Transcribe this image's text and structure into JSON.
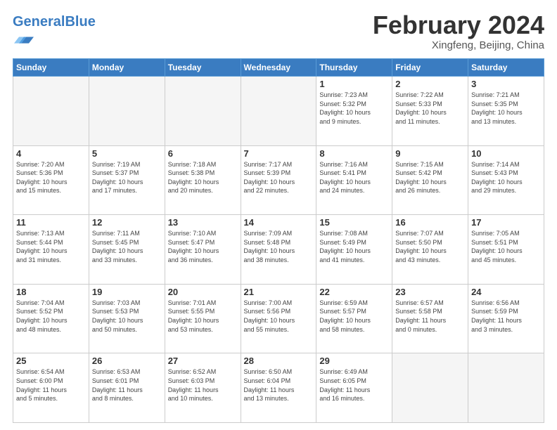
{
  "header": {
    "logo_general": "General",
    "logo_blue": "Blue",
    "month_title": "February 2024",
    "subtitle": "Xingfeng, Beijing, China"
  },
  "days_of_week": [
    "Sunday",
    "Monday",
    "Tuesday",
    "Wednesday",
    "Thursday",
    "Friday",
    "Saturday"
  ],
  "weeks": [
    [
      {
        "day": "",
        "info": ""
      },
      {
        "day": "",
        "info": ""
      },
      {
        "day": "",
        "info": ""
      },
      {
        "day": "",
        "info": ""
      },
      {
        "day": "1",
        "info": "Sunrise: 7:23 AM\nSunset: 5:32 PM\nDaylight: 10 hours\nand 9 minutes."
      },
      {
        "day": "2",
        "info": "Sunrise: 7:22 AM\nSunset: 5:33 PM\nDaylight: 10 hours\nand 11 minutes."
      },
      {
        "day": "3",
        "info": "Sunrise: 7:21 AM\nSunset: 5:35 PM\nDaylight: 10 hours\nand 13 minutes."
      }
    ],
    [
      {
        "day": "4",
        "info": "Sunrise: 7:20 AM\nSunset: 5:36 PM\nDaylight: 10 hours\nand 15 minutes."
      },
      {
        "day": "5",
        "info": "Sunrise: 7:19 AM\nSunset: 5:37 PM\nDaylight: 10 hours\nand 17 minutes."
      },
      {
        "day": "6",
        "info": "Sunrise: 7:18 AM\nSunset: 5:38 PM\nDaylight: 10 hours\nand 20 minutes."
      },
      {
        "day": "7",
        "info": "Sunrise: 7:17 AM\nSunset: 5:39 PM\nDaylight: 10 hours\nand 22 minutes."
      },
      {
        "day": "8",
        "info": "Sunrise: 7:16 AM\nSunset: 5:41 PM\nDaylight: 10 hours\nand 24 minutes."
      },
      {
        "day": "9",
        "info": "Sunrise: 7:15 AM\nSunset: 5:42 PM\nDaylight: 10 hours\nand 26 minutes."
      },
      {
        "day": "10",
        "info": "Sunrise: 7:14 AM\nSunset: 5:43 PM\nDaylight: 10 hours\nand 29 minutes."
      }
    ],
    [
      {
        "day": "11",
        "info": "Sunrise: 7:13 AM\nSunset: 5:44 PM\nDaylight: 10 hours\nand 31 minutes."
      },
      {
        "day": "12",
        "info": "Sunrise: 7:11 AM\nSunset: 5:45 PM\nDaylight: 10 hours\nand 33 minutes."
      },
      {
        "day": "13",
        "info": "Sunrise: 7:10 AM\nSunset: 5:47 PM\nDaylight: 10 hours\nand 36 minutes."
      },
      {
        "day": "14",
        "info": "Sunrise: 7:09 AM\nSunset: 5:48 PM\nDaylight: 10 hours\nand 38 minutes."
      },
      {
        "day": "15",
        "info": "Sunrise: 7:08 AM\nSunset: 5:49 PM\nDaylight: 10 hours\nand 41 minutes."
      },
      {
        "day": "16",
        "info": "Sunrise: 7:07 AM\nSunset: 5:50 PM\nDaylight: 10 hours\nand 43 minutes."
      },
      {
        "day": "17",
        "info": "Sunrise: 7:05 AM\nSunset: 5:51 PM\nDaylight: 10 hours\nand 45 minutes."
      }
    ],
    [
      {
        "day": "18",
        "info": "Sunrise: 7:04 AM\nSunset: 5:52 PM\nDaylight: 10 hours\nand 48 minutes."
      },
      {
        "day": "19",
        "info": "Sunrise: 7:03 AM\nSunset: 5:53 PM\nDaylight: 10 hours\nand 50 minutes."
      },
      {
        "day": "20",
        "info": "Sunrise: 7:01 AM\nSunset: 5:55 PM\nDaylight: 10 hours\nand 53 minutes."
      },
      {
        "day": "21",
        "info": "Sunrise: 7:00 AM\nSunset: 5:56 PM\nDaylight: 10 hours\nand 55 minutes."
      },
      {
        "day": "22",
        "info": "Sunrise: 6:59 AM\nSunset: 5:57 PM\nDaylight: 10 hours\nand 58 minutes."
      },
      {
        "day": "23",
        "info": "Sunrise: 6:57 AM\nSunset: 5:58 PM\nDaylight: 11 hours\nand 0 minutes."
      },
      {
        "day": "24",
        "info": "Sunrise: 6:56 AM\nSunset: 5:59 PM\nDaylight: 11 hours\nand 3 minutes."
      }
    ],
    [
      {
        "day": "25",
        "info": "Sunrise: 6:54 AM\nSunset: 6:00 PM\nDaylight: 11 hours\nand 5 minutes."
      },
      {
        "day": "26",
        "info": "Sunrise: 6:53 AM\nSunset: 6:01 PM\nDaylight: 11 hours\nand 8 minutes."
      },
      {
        "day": "27",
        "info": "Sunrise: 6:52 AM\nSunset: 6:03 PM\nDaylight: 11 hours\nand 10 minutes."
      },
      {
        "day": "28",
        "info": "Sunrise: 6:50 AM\nSunset: 6:04 PM\nDaylight: 11 hours\nand 13 minutes."
      },
      {
        "day": "29",
        "info": "Sunrise: 6:49 AM\nSunset: 6:05 PM\nDaylight: 11 hours\nand 16 minutes."
      },
      {
        "day": "",
        "info": ""
      },
      {
        "day": "",
        "info": ""
      }
    ]
  ]
}
